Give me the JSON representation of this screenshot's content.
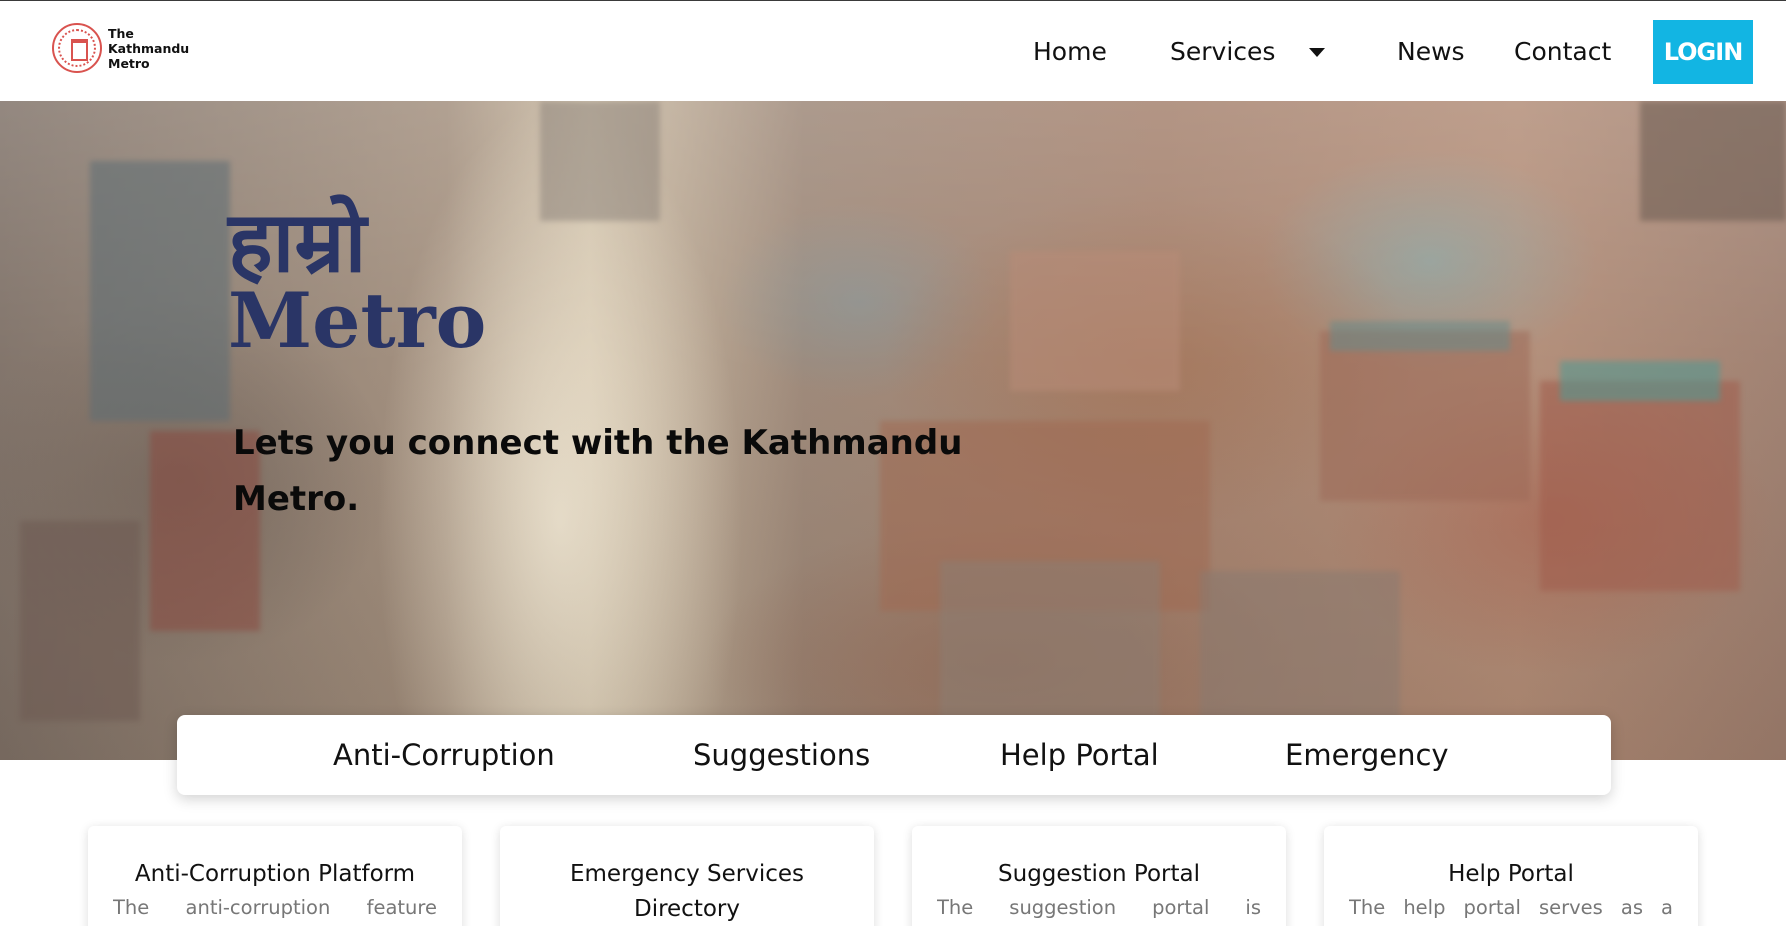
{
  "brand": {
    "logo_icon": "kathmandu-metro-seal",
    "logo_lines": [
      "The",
      "Kathmandu",
      "Metro"
    ]
  },
  "nav": {
    "home": "Home",
    "services": "Services",
    "services_icon": "caret-down-icon",
    "news": "News",
    "contact": "Contact",
    "login": "LOGIN"
  },
  "colors": {
    "accent": "#12b5e3",
    "hero_title": "#2a3566"
  },
  "hero": {
    "title_nepali": "हाम्रो",
    "title_english": "Metro",
    "tagline": "Lets you connect with the Kathmandu Metro."
  },
  "quick_tabs": [
    "Anti-Corruption",
    "Suggestions",
    "Help Portal",
    "Emergency"
  ],
  "cards": [
    {
      "title": "Anti-Corruption Platform",
      "description": "The anti-corruption feature"
    },
    {
      "title": "Emergency Services Directory",
      "description": ""
    },
    {
      "title": "Suggestion Portal",
      "description": "The suggestion portal is"
    },
    {
      "title": "Help Portal",
      "description": "The help portal serves as a"
    }
  ]
}
